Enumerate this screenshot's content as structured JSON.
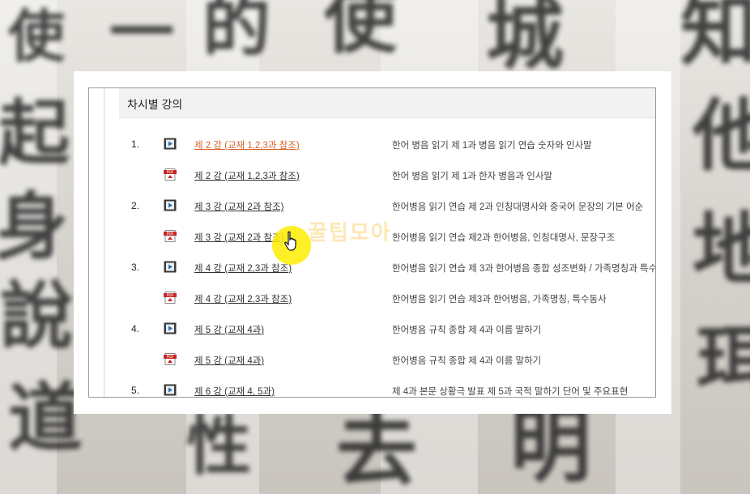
{
  "section_title": "차시별 강의",
  "watermark": "꿀팁모아",
  "lessons": [
    {
      "num": "1.",
      "type": "video",
      "link": "제 2 강 (교재 1,2,3과 참조)",
      "desc": "한어 병음 읽기 제 1과 병음 읽기 연습 숫자와 인사말",
      "active": true
    },
    {
      "num": "",
      "type": "pdf",
      "link": "제 2 강 (교재 1,2,3과 참조)",
      "desc": "한어 병음 읽기 제 1과 한자 병음과 인사말"
    },
    {
      "num": "2.",
      "type": "video",
      "link": "제 3 강 (교재 2과 참조)",
      "desc": "한어병음 읽기 연습 제 2과 인칭대명사와 중국어 문장의 기본 어순"
    },
    {
      "num": "",
      "type": "pdf",
      "link": "제 3 강 (교재 2과 참조)",
      "desc": "한어병음 읽기 연습 제2과 한어병음, 인칭대명사, 문장구조"
    },
    {
      "num": "3.",
      "type": "video",
      "link": "제 4 강 (교재 2,3과 참조)",
      "desc": "한어병음 읽기 연습 제 3과 한어병음 종합 성조변화 / 가족명칭과 특수"
    },
    {
      "num": "",
      "type": "pdf",
      "link": "제 4 강 (교재 2,3과 참조)",
      "desc": "한어병음 읽기 연습 제3과 한어병음, 가족명칭, 특수동사"
    },
    {
      "num": "4.",
      "type": "video",
      "link": "제 5 강 (교재 4과)",
      "desc": "한어병음 규칙 종합 제 4과 이름 말하기"
    },
    {
      "num": "",
      "type": "pdf",
      "link": "제 5 강 (교재 4과)",
      "desc": "한어병음 규칙 종합 제 4과 이름 말하기"
    },
    {
      "num": "5.",
      "type": "video",
      "link": "제 6 강 (교재 4, 5과)",
      "desc": "제 4과 본문 상황극 발표 제 5과 국적 말하기 단어 및 주요표현"
    }
  ],
  "colors": {
    "active_link": "#d9622b",
    "highlight": "#ffec00"
  },
  "icons": {
    "video": "video-play-icon",
    "pdf": "pdf-file-icon",
    "cursor": "hand-pointer-icon"
  }
}
